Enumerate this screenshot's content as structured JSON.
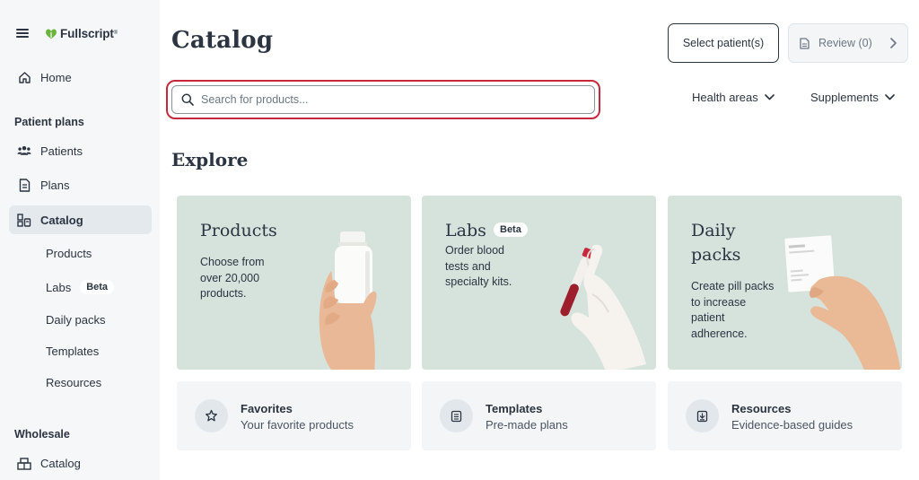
{
  "brand": {
    "name": "Fullscript",
    "tm": "®"
  },
  "nav": {
    "home": "Home",
    "patient_plans_label": "Patient plans",
    "patients": "Patients",
    "plans": "Plans",
    "catalog": "Catalog",
    "catalog_sub": {
      "products": "Products",
      "labs": "Labs",
      "labs_badge": "Beta",
      "daily_packs": "Daily packs",
      "templates": "Templates",
      "resources": "Resources"
    },
    "wholesale_label": "Wholesale",
    "wholesale_catalog": "Catalog"
  },
  "header": {
    "title": "Catalog",
    "select_patients": "Select patient(s)",
    "review": "Review (0)"
  },
  "search": {
    "placeholder": "Search for products...",
    "value": ""
  },
  "filters": {
    "health_areas": "Health areas",
    "supplements": "Supplements"
  },
  "explore": {
    "title": "Explore",
    "cards": [
      {
        "title": "Products",
        "desc_lines": [
          "Choose from",
          "over 20,000",
          "products."
        ]
      },
      {
        "title": "Labs",
        "badge": "Beta",
        "desc_lines": [
          "Order blood",
          "tests and",
          "specialty kits."
        ]
      },
      {
        "title_lines": [
          "Daily",
          "packs"
        ],
        "desc_lines": [
          "Create pill packs",
          "to increase",
          "patient",
          "adherence."
        ]
      }
    ]
  },
  "quick_links": [
    {
      "title": "Favorites",
      "subtitle": "Your favorite products",
      "icon": "star-icon"
    },
    {
      "title": "Templates",
      "subtitle": "Pre-made plans",
      "icon": "template-icon"
    },
    {
      "title": "Resources",
      "subtitle": "Evidence-based guides",
      "icon": "resource-icon"
    }
  ],
  "colors": {
    "accent_red": "#c8283d",
    "card_green": "#d6e2dc",
    "sidebar_bg": "#f5f7f9",
    "active_bg": "#e4e9ee",
    "text": "#2b3440",
    "brand_green": "#6cb33f"
  }
}
